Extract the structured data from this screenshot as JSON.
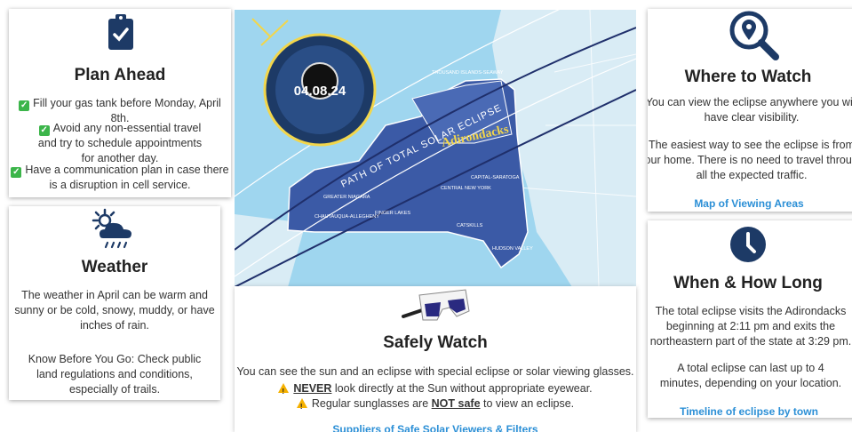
{
  "plan": {
    "title": "Plan Ahead",
    "icon": "clipboard-check-icon",
    "items": [
      "Fill your gas tank before Monday, April 8th.",
      "Avoid any non-essential travel and try to schedule appointments for another day.",
      "Have a communication plan in case there is a disruption in cell service."
    ]
  },
  "weather": {
    "title": "Weather",
    "icon": "cloud-sun-rain-icon",
    "p1": "The weather in April can be warm and sunny or be cold, snowy, muddy, or have inches of rain.",
    "p2": "Know Before You Go: Check public land regulations and conditions, especially of trails."
  },
  "map": {
    "badge_date": "04.08.24",
    "path_label": "PATH OF TOTAL SOLAR ECLIPSE",
    "highlight_region": "Adirondacks",
    "regions": [
      "THOUSAND ISLANDS-SEAWAY",
      "GREATER NIAGARA",
      "CHAUTAUQUA-ALLEGHENY",
      "FINGER LAKES",
      "CENTRAL NEW YORK",
      "CAPITAL-SARATOGA",
      "CATSKILLS",
      "HUDSON VALLEY"
    ],
    "colors": {
      "water": "#9fd6ef",
      "land": "#d9ecf5",
      "state": "#3b5aa6",
      "path": "#1f2f6b",
      "highlight": "#f2d64b"
    }
  },
  "safely": {
    "title": "Safely Watch",
    "icon": "eclipse-glasses-icon",
    "line1": "You can see the sun and an eclipse with special eclipse or solar viewing glasses.",
    "line2_em": "NEVER",
    "line2_rest": " look directly at the Sun without appropriate eyewear.",
    "line3_pre": "Regular sunglasses are ",
    "line3_em": "NOT safe",
    "line3_post": " to view an eclipse.",
    "link": "Suppliers of Safe Solar Viewers & Filters"
  },
  "where": {
    "title": "Where to Watch",
    "icon": "map-search-icon",
    "p1": "You can view the eclipse anywhere you will have clear visibility.",
    "p2": "The easiest way to see the eclipse is from your home. There is no need to travel through all the expected traffic.",
    "link": "Map of Viewing Areas"
  },
  "when": {
    "title": "When & How Long",
    "icon": "clock-icon",
    "p1": "The total eclipse visits the Adirondacks beginning at 2:11 pm and exits the northeastern part of the state at 3:29 pm.",
    "p2": "A total eclipse can last up to 4 minutes, depending on your location.",
    "link": "Timeline of eclipse by town"
  },
  "colors": {
    "navy": "#1d3a66",
    "link": "#2b8fd6",
    "check": "#3cb54a",
    "warn": "#f5b100"
  }
}
